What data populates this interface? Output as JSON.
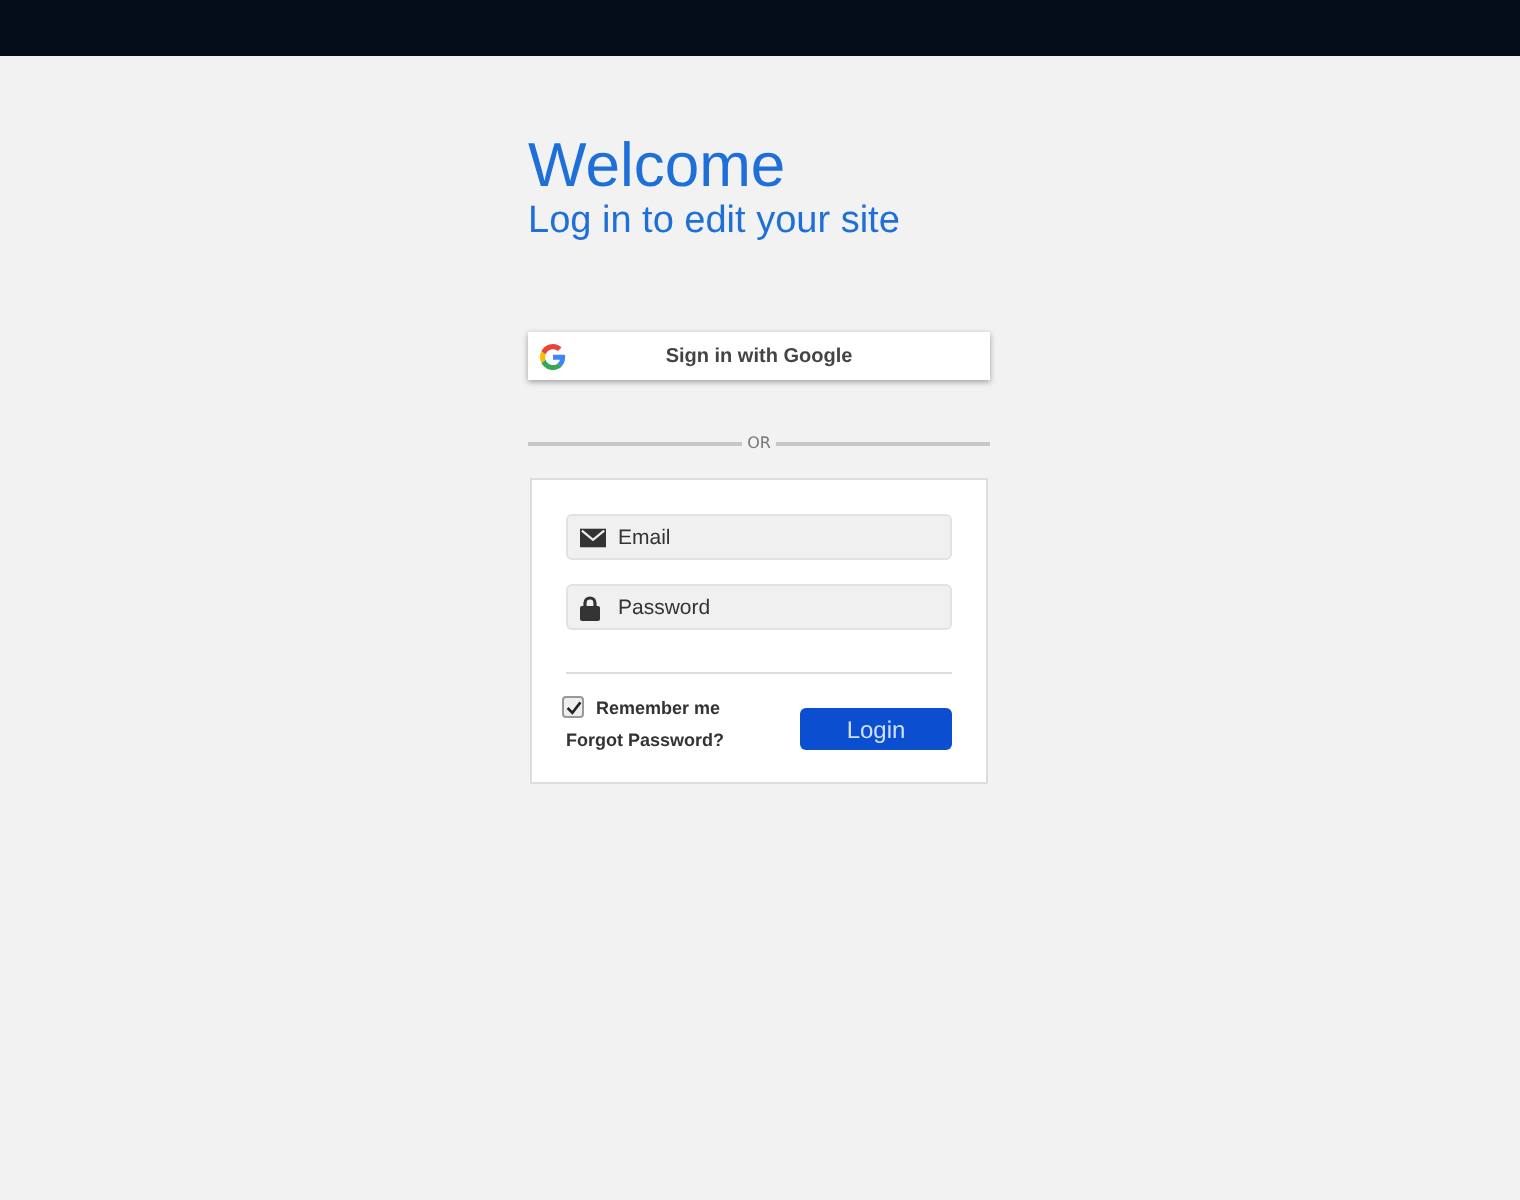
{
  "heading": {
    "title": "Welcome",
    "subtitle": "Log in to edit your site"
  },
  "google_button": {
    "label": "Sign in with Google"
  },
  "divider_label": "OR",
  "form": {
    "fields": [
      {
        "kind": "email",
        "placeholder": "Email"
      },
      {
        "kind": "password",
        "placeholder": "Password"
      }
    ],
    "remember": {
      "label": "Remember me",
      "checked": true
    },
    "forgot_link": "Forgot Password?",
    "submit": "Login"
  }
}
